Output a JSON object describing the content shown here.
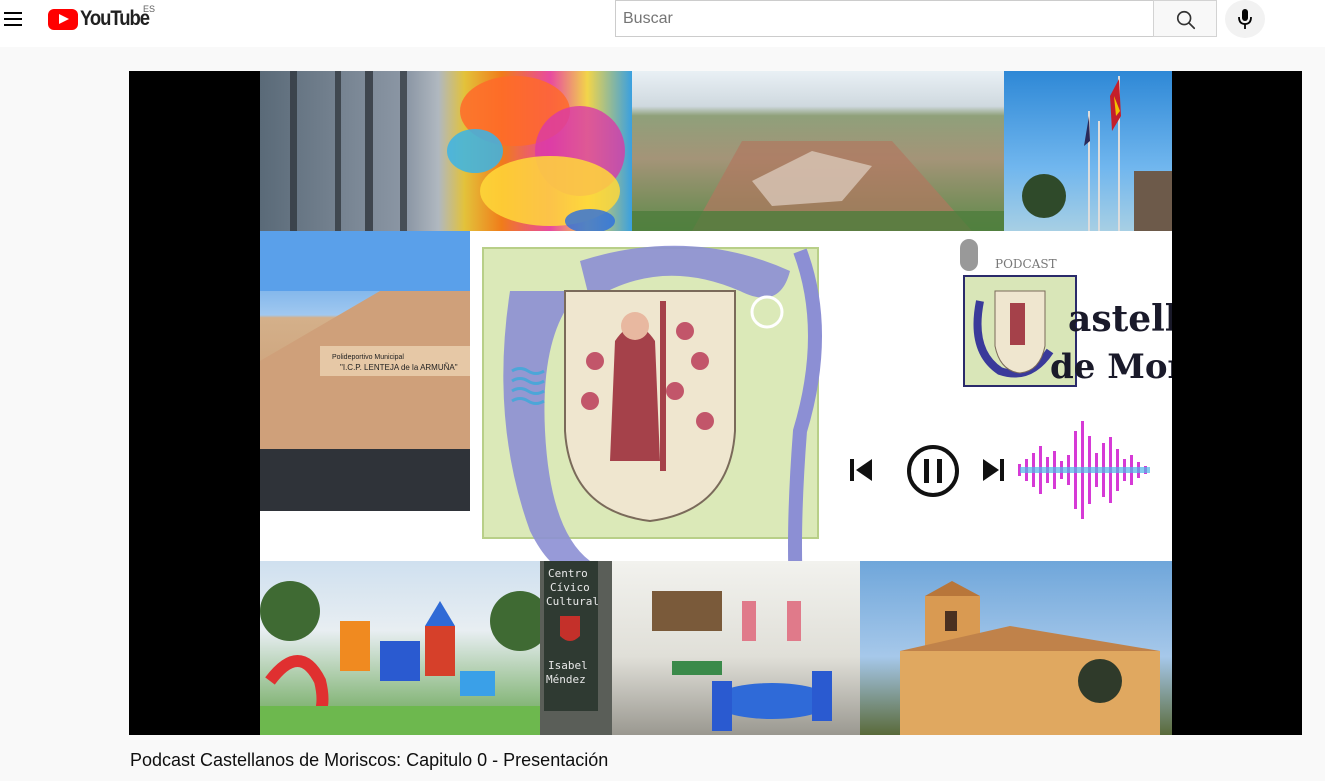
{
  "header": {
    "logo_text": "YouTube",
    "country_code": "ES",
    "search_placeholder": "Buscar"
  },
  "video": {
    "title": "Podcast Castellanos de Moriscos: Capitulo 0 - Presentación",
    "thumbnail_text": {
      "podcast_badge": "PODCAST",
      "heading_line1": "astellanos",
      "heading_line2": "de Moriscos",
      "sign_line1": "Polideportivo Municipal",
      "sign_line2": "\"I.C.P. LENTEJA de la ARMUÑA\"",
      "center_line1": "Centro",
      "center_line2": "Cívico",
      "center_line3": "Cultural",
      "center_line4": "Isabel",
      "center_line5": "Méndez"
    }
  },
  "colors": {
    "brand_red": "#ff0000",
    "title_text": "#0f0f0f",
    "ornament_blue": "#8c8fd4",
    "podcast_magenta": "#d63ad6"
  },
  "icons": [
    "menu-icon",
    "youtube-logo-icon",
    "search-icon",
    "microphone-icon",
    "previous-icon",
    "pause-icon",
    "next-icon",
    "microphone-badge-icon"
  ]
}
